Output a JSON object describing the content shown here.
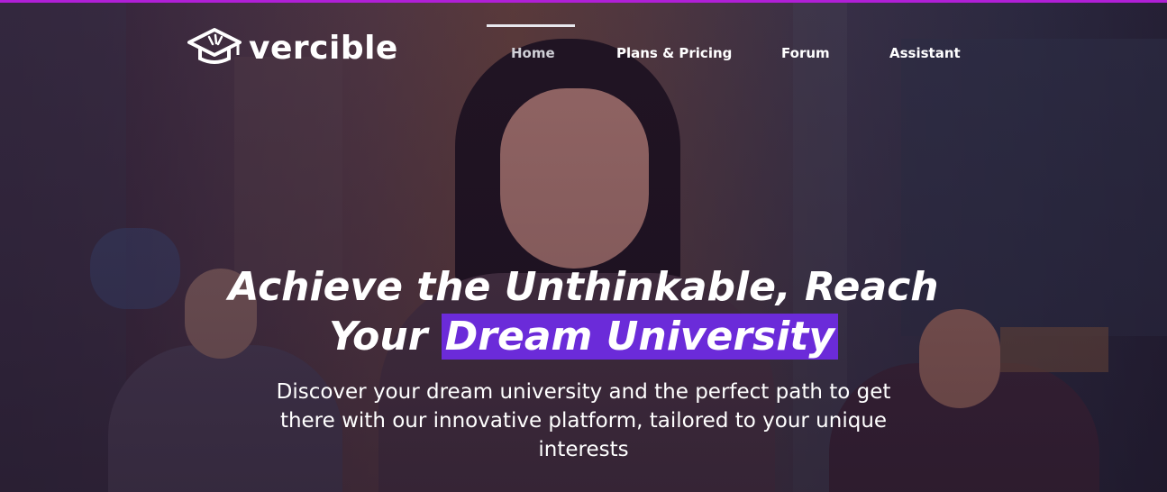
{
  "brand": {
    "name": "vercible"
  },
  "nav": {
    "items": [
      {
        "label": "Home",
        "active": true
      },
      {
        "label": "Plans & Pricing",
        "active": false
      },
      {
        "label": "Forum",
        "active": false
      },
      {
        "label": "Assistant",
        "active": false
      }
    ]
  },
  "hero": {
    "headline_line1": "Achieve the Unthinkable, Reach",
    "headline_line2_prefix": "Your ",
    "headline_line2_highlight": "Dream University",
    "subtitle": "Discover your dream university and the perfect path to get there with our innovative platform, tailored to your unique interests",
    "highlight_color": "#6b2bd9",
    "top_border_color": "#b01fd6"
  }
}
